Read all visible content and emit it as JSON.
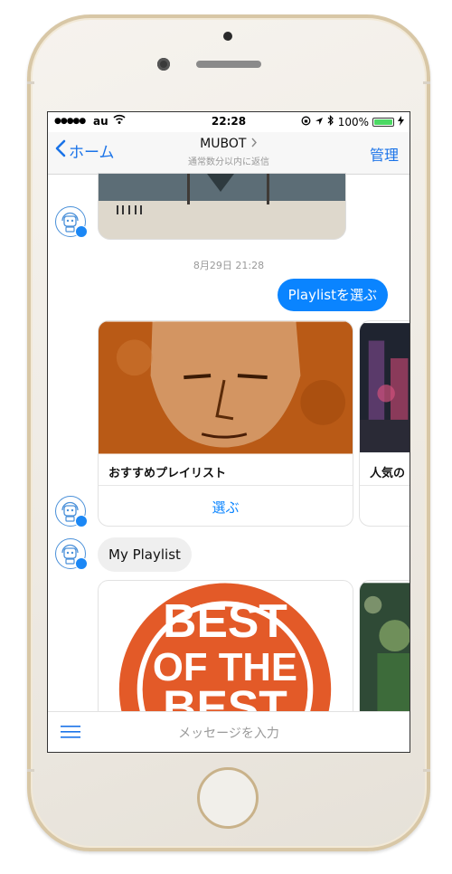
{
  "status_bar": {
    "signal": "●●●●●",
    "carrier": "au",
    "time": "22:28",
    "battery": "100%",
    "battery_level": 1.0
  },
  "nav": {
    "back_label": "ホーム",
    "title": "MUBOT",
    "subtitle": "通常数分以内に返信",
    "manage_label": "管理"
  },
  "conversation": {
    "timestamp": "8月29日 21:28",
    "sent_message": "Playlistを選ぶ",
    "cards": [
      {
        "title": "おすすめプレイリスト",
        "button": "選ぶ"
      },
      {
        "title": "人気の",
        "button": ""
      }
    ],
    "received_message": "My Playlist",
    "playlist_cards": [
      {
        "title": "BEST OF THE BEST"
      },
      {
        "title": ""
      }
    ]
  },
  "composer": {
    "placeholder": "メッセージを入力"
  },
  "colors": {
    "accent": "#0a84ff",
    "battery": "#4cd964",
    "phone_frame": "#d8c7a6"
  }
}
